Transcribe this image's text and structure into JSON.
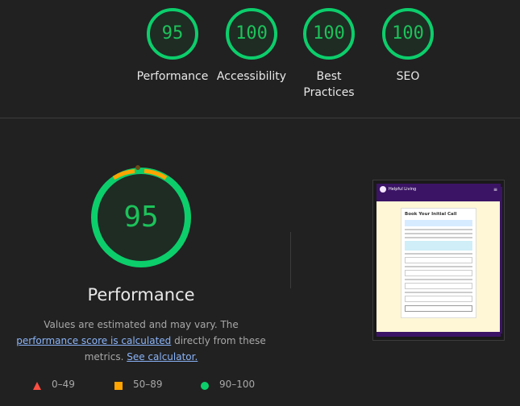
{
  "categories": [
    {
      "label": "Performance",
      "score": "95",
      "fraction": 0.95
    },
    {
      "label": "Accessibility",
      "score": "100",
      "fraction": 1.0
    },
    {
      "label": "Best Practices",
      "score": "100",
      "fraction": 1.0
    },
    {
      "label": "SEO",
      "score": "100",
      "fraction": 1.0
    }
  ],
  "main": {
    "score": "95",
    "fraction": 0.95,
    "title": "Performance",
    "note_prefix": "Values are estimated and may vary. The ",
    "note_link1": "performance score is calculated",
    "note_mid": " directly from these metrics. ",
    "note_link2": "See calculator."
  },
  "legend": [
    {
      "range": "0–49",
      "shape": "triangle",
      "color": "#ff4e42"
    },
    {
      "range": "50–89",
      "shape": "square",
      "color": "#ffa400"
    },
    {
      "range": "90–100",
      "shape": "circle",
      "color": "#0cce6b"
    }
  ],
  "screenshot": {
    "brand": "Helpful Living",
    "menu_icon": "hamburger-icon",
    "card_title": "Book Your Initial Call"
  },
  "colors": {
    "pass": "#0cce6b",
    "pass_text": "#1dc25a",
    "average": "#ffa400",
    "fail": "#ff4e42",
    "ring_bg": "#1e3b2a"
  }
}
